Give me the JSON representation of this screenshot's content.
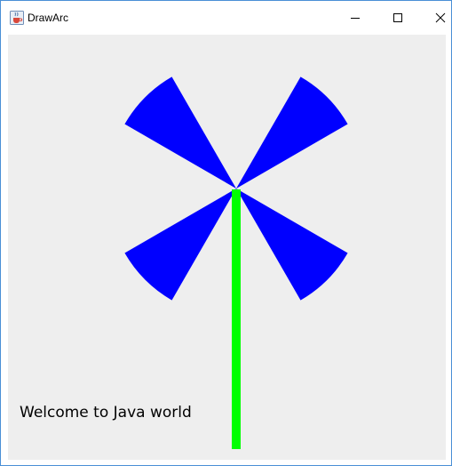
{
  "window": {
    "title": "DrawArc",
    "icon": "java-cup-icon",
    "controls": [
      "minimize",
      "maximize",
      "close"
    ]
  },
  "canvas": {
    "background": "#eeeeee",
    "pinwheel": {
      "color": "#0000ff",
      "arcs": [
        {
          "start_angle": 30,
          "arc_angle": 30
        },
        {
          "start_angle": 120,
          "arc_angle": 30
        },
        {
          "start_angle": 210,
          "arc_angle": 30
        },
        {
          "start_angle": 300,
          "arc_angle": 30
        }
      ]
    },
    "stem": {
      "color": "#00ff00"
    },
    "message": "Welcome to Java world"
  }
}
